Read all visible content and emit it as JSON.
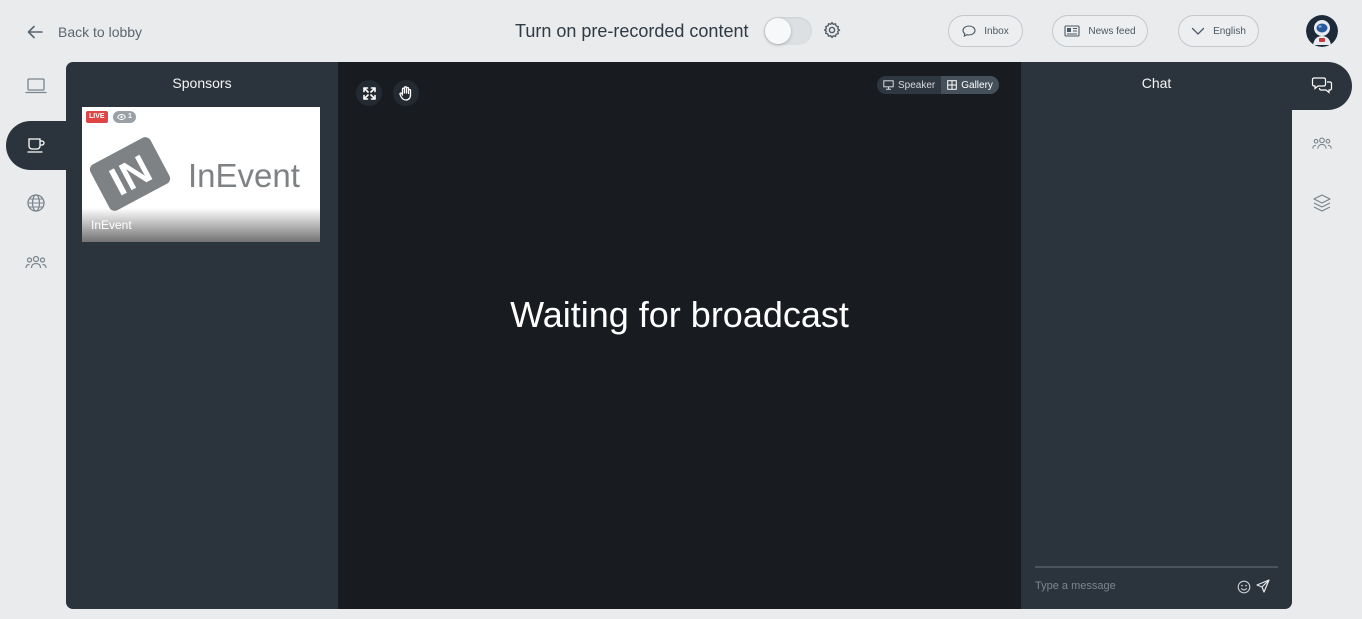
{
  "topbar": {
    "back_label": "Back to lobby",
    "prerecorded_label": "Turn on pre-recorded content",
    "prerecorded_on": false,
    "inbox_label": "Inbox",
    "news_feed_label": "News feed",
    "language_label": "English"
  },
  "left_nav": {
    "items": [
      "laptop-icon",
      "coffee-cup-icon",
      "globe-icon",
      "people-icon"
    ],
    "active_index": 1
  },
  "sponsors": {
    "title": "Sponsors",
    "cards": [
      {
        "name": "InEvent",
        "live_badge": "LIVE",
        "viewers": "1",
        "logo_text": "InEvent",
        "logo_mark": "IN"
      }
    ]
  },
  "stage": {
    "waiting_text": "Waiting for broadcast",
    "view_options": [
      "Speaker",
      "Gallery"
    ],
    "active_view": "Gallery"
  },
  "chat": {
    "title": "Chat",
    "input_placeholder": "Type a message"
  },
  "right_nav": {
    "items": [
      "chat-bubbles-icon",
      "people-icon",
      "layers-icon"
    ],
    "active_index": 0
  },
  "colors": {
    "page_bg": "#e9ebed",
    "panel_bg": "#2b343c",
    "stage_bg": "#181c21",
    "live_red": "#e04545"
  }
}
